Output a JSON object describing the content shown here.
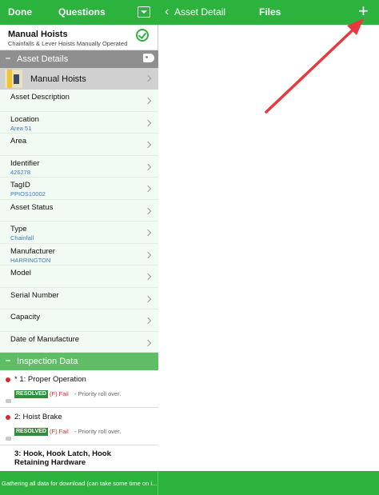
{
  "left_toolbar": {
    "done_label": "Done",
    "title": "Questions"
  },
  "right_toolbar": {
    "back_label": "Asset Detail",
    "title": "Files",
    "add_symbol": "+"
  },
  "header": {
    "title": "Manual Hoists",
    "subtitle": "Chainfalls & Lever Hoists Manually Operated"
  },
  "asset_details": {
    "section_label": "Asset Details",
    "asset_name": "Manual Hoists",
    "fields": [
      {
        "label": "Asset Description",
        "value": ""
      },
      {
        "label": "Location",
        "value": "Area 51"
      },
      {
        "label": "Area",
        "value": ""
      },
      {
        "label": "Identifier",
        "value": "426278"
      },
      {
        "label": "TagID",
        "value": "PPIOS10002"
      },
      {
        "label": "Asset Status",
        "value": ""
      },
      {
        "label": "Type",
        "value": "Chainfall"
      },
      {
        "label": "Manufacturer",
        "value": "HARRINGTON"
      },
      {
        "label": "Model",
        "value": ""
      },
      {
        "label": "Serial Number",
        "value": ""
      },
      {
        "label": "Capacity",
        "value": ""
      },
      {
        "label": "Date of Manufacture",
        "value": ""
      }
    ]
  },
  "inspection": {
    "section_label": "Inspection Data",
    "items": [
      {
        "title": "* 1: Proper Operation",
        "badge": "RESOLVED",
        "result": "(F) Fail",
        "note": "- Priority roll over."
      },
      {
        "title": "2: Hoist Brake",
        "badge": "RESOLVED",
        "result": "(F) Fail",
        "note": "- Priority roll over."
      },
      {
        "title_line1": "3: Hook, Hook Latch, Hook",
        "title_line2": "Retaining Hardware"
      }
    ]
  },
  "status_bar": {
    "text": "Gathering all data for download (can take some time on i..."
  },
  "colors": {
    "accent_green": "#2bb33e",
    "fail_red": "#d92b2b",
    "resolved_badge": "#2e8f3c",
    "annotation_arrow": "#e8393f"
  },
  "icons": [
    "chevron-left-icon",
    "dropdown-icon",
    "add-icon",
    "check-circle-icon",
    "tag-icon",
    "chevron-right-icon",
    "comment-icon"
  ]
}
